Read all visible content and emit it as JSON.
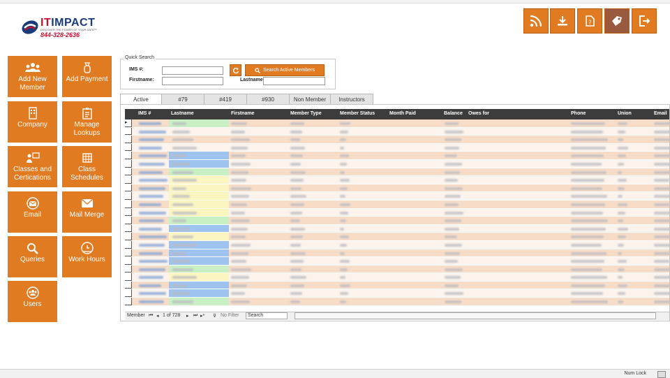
{
  "logo": {
    "brand_it": "IT",
    "brand_rest": "IMPACT",
    "tagline": "DISCOVER THE POWER OF YOUR DATA™",
    "phone": "844-328-2636"
  },
  "sidebar": {
    "add_member": "Add New Member",
    "add_payment": "Add Payment",
    "company": "Company",
    "manage_lookups": "Manage Lookups",
    "classes": "Classes and Certications",
    "class_schedules": "Class Schedules",
    "email": "Email",
    "mail_merge": "Mail Merge",
    "queries": "Queries",
    "work_hours": "Work Hours",
    "users": "Users"
  },
  "quick_search": {
    "legend": "Quick Search",
    "ims_label": "IMS #:",
    "firstname_label": "Firstname:",
    "lastname_label": "Lastname:",
    "search_button": "Search Active Members"
  },
  "tabs": [
    "Active",
    "#79",
    "#419",
    "#930",
    "Non Member",
    "Instructors"
  ],
  "grid": {
    "headers": [
      "IMS #",
      "Lastname",
      "Firstname",
      "Member Type",
      "Member Status",
      "Month Paid",
      "Balance",
      "Owes for",
      "Phone",
      "Union",
      "Email"
    ]
  },
  "nav": {
    "record_label": "Member",
    "position": "1 of 728",
    "filter": "No Filter",
    "search": "Search"
  },
  "status": {
    "numlock": "Num Lock"
  },
  "colors": {
    "accent": "#e07b22",
    "header": "#3c3c3c",
    "row_alt": "#f7ddc8"
  }
}
